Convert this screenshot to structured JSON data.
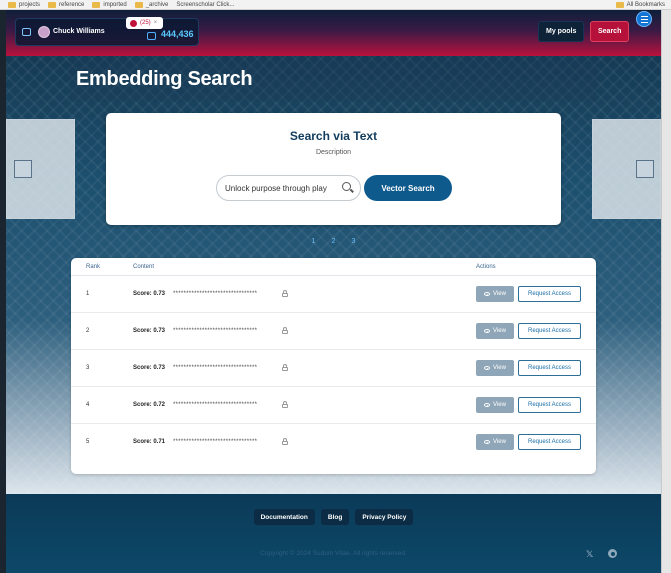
{
  "bookmarks": {
    "items": [
      {
        "label": "projects"
      },
      {
        "label": "reference"
      },
      {
        "label": "imported"
      },
      {
        "label": "_archive"
      },
      {
        "label": "Screenscholar Click..."
      }
    ],
    "all_bookmarks": "All Bookmarks"
  },
  "header": {
    "user_name": "Chuck Williams",
    "notification_count": "(25)",
    "notification_close": "×",
    "balance": "444,436",
    "my_pools_label": "My pools",
    "search_label": "Search"
  },
  "hero": {
    "title": "Embedding Search"
  },
  "search": {
    "title": "Search via Text",
    "description": "Description",
    "input_value": "Unlock purpose through play",
    "button_label": "Vector Search"
  },
  "pagination": [
    "1",
    "2",
    "3"
  ],
  "results": {
    "columns": {
      "rank": "Rank",
      "content": "Content",
      "actions": "Actions"
    },
    "rows": [
      {
        "rank": "1",
        "score": "Score: 0.73",
        "content": "********************************",
        "view": "View",
        "request": "Request Access"
      },
      {
        "rank": "2",
        "score": "Score: 0.73",
        "content": "********************************",
        "view": "View",
        "request": "Request Access"
      },
      {
        "rank": "3",
        "score": "Score: 0.73",
        "content": "********************************",
        "view": "View",
        "request": "Request Access"
      },
      {
        "rank": "4",
        "score": "Score: 0.72",
        "content": "********************************",
        "view": "View",
        "request": "Request Access"
      },
      {
        "rank": "5",
        "score": "Score: 0.71",
        "content": "********************************",
        "view": "View",
        "request": "Request Access"
      }
    ]
  },
  "footer": {
    "links": [
      "Documentation",
      "Blog",
      "Privacy Policy"
    ],
    "copyright": "Copyright © 2024 Sudum Vitae. All rights reserved.",
    "x_icon_glyph": "𝕏"
  },
  "colors": {
    "primary": "#0f5a8c",
    "accent": "#b5113b",
    "header_dark": "#0e1f3a",
    "view_button": "#8fa6b8"
  }
}
